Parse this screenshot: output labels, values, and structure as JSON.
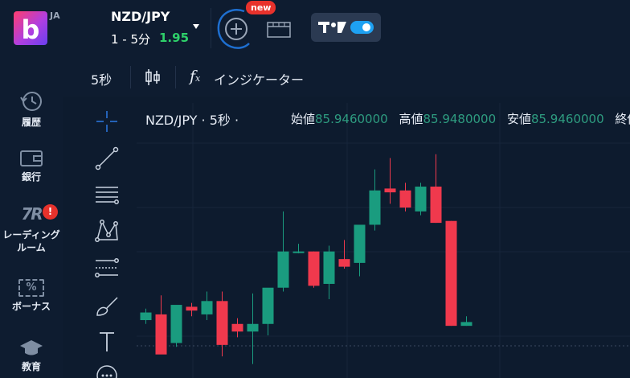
{
  "header": {
    "logo_letter": "b",
    "region": "JA",
    "pair": "NZD/JPY",
    "duration": "1 - 5分",
    "payout": "1.95",
    "new_badge": "new",
    "tv_label": "TV",
    "tv_toggle_on": true
  },
  "left_nav": {
    "items": [
      {
        "label": "履歴",
        "icon": "history-icon"
      },
      {
        "label": "銀行",
        "icon": "wallet-icon"
      },
      {
        "label": "レーディング\nルーム",
        "icon": "trading-room-icon",
        "icon_text": "7R",
        "badge": "!"
      },
      {
        "label": "ボーナス",
        "icon": "bonus-ticket-icon",
        "icon_text": "%"
      },
      {
        "label": "教育",
        "icon": "graduation-cap-icon"
      }
    ]
  },
  "chart_toolbar": {
    "timeframe": "5秒",
    "indicator_fx": "f",
    "indicator_label": "インジケーター"
  },
  "draw_tools": [
    "crosshair-icon",
    "trend-line-icon",
    "horizontal-lines-icon",
    "pattern-icon",
    "fib-icon",
    "brush-icon",
    "text-icon",
    "more-icon"
  ],
  "chart": {
    "legend_title": "NZD/JPY · 5秒 ·",
    "open_label": "始値",
    "open_value": "85.9460000",
    "high_label": "高値",
    "high_value": "85.9480000",
    "low_label": "安値",
    "low_value": "85.9460000",
    "close_label": "終値"
  },
  "colors": {
    "bg": "#0d1b2e",
    "panel": "#0e1c30",
    "up": "#1a9c7f",
    "down": "#f0394d",
    "payout": "#2ed06a",
    "badge": "#e8322c",
    "toggle": "#1ea1f2"
  },
  "chart_data": {
    "type": "candlestick",
    "candles": [
      {
        "o": 3,
        "h": 9,
        "l": 1,
        "c": 7
      },
      {
        "o": 6,
        "h": 16,
        "l": -8,
        "c": -15
      },
      {
        "o": -9,
        "h": -1,
        "l": -11,
        "c": 11
      },
      {
        "o": 10,
        "h": 12,
        "l": 5,
        "c": 8
      },
      {
        "o": 6,
        "h": 18,
        "l": 3,
        "c": 13
      },
      {
        "o": 13,
        "h": 18,
        "l": -16,
        "c": -10
      },
      {
        "o": 1,
        "h": 4,
        "l": -6,
        "c": -3
      },
      {
        "o": -3,
        "h": 17,
        "l": -20,
        "c": 1
      },
      {
        "o": 1,
        "h": 9,
        "l": -5,
        "c": 20
      },
      {
        "o": 20,
        "h": 60,
        "l": 18,
        "c": 39
      },
      {
        "o": 39,
        "h": 43,
        "l": 38,
        "c": 39
      },
      {
        "o": 39,
        "h": 39,
        "l": 20,
        "c": 21
      },
      {
        "o": 22,
        "h": 42,
        "l": 14,
        "c": 39
      },
      {
        "o": 35,
        "h": 45,
        "l": 30,
        "c": 31
      },
      {
        "o": 33,
        "h": 45,
        "l": 26,
        "c": 53
      },
      {
        "o": 53,
        "h": 82,
        "l": 50,
        "c": 71
      },
      {
        "o": 72,
        "h": 88,
        "l": 64,
        "c": 70
      },
      {
        "o": 71,
        "h": 75,
        "l": 60,
        "c": 62
      },
      {
        "o": 60,
        "h": 75,
        "l": 58,
        "c": 73
      },
      {
        "o": 73,
        "h": 90,
        "l": 54,
        "c": 54
      },
      {
        "o": 55,
        "h": 55,
        "l": 0,
        "c": 0
      },
      {
        "o": 0,
        "h": 5,
        "l": 0,
        "c": 2
      }
    ]
  }
}
